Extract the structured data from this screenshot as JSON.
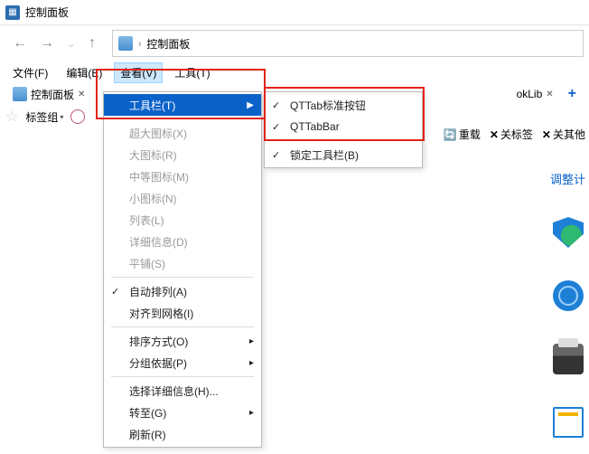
{
  "title": "控制面板",
  "breadcrumb": {
    "root": "控制面板"
  },
  "menubar": {
    "file": "文件(F)",
    "edit": "编辑(E)",
    "view": "查看(V)",
    "tools": "工具(T)"
  },
  "tabs": {
    "tab1": "控制面板",
    "tab2_suffix": "okLib"
  },
  "tabbar": {
    "label": "标签组"
  },
  "right_tools": {
    "reset": "重载",
    "close_tab": "关标签",
    "close_other": "关其他"
  },
  "adjust_link": "调整计",
  "view_menu": {
    "toolbar": "工具栏(T)",
    "xl_icons": "超大图标(X)",
    "l_icons": "大图标(R)",
    "m_icons": "中等图标(M)",
    "s_icons": "小图标(N)",
    "list": "列表(L)",
    "details": "详细信息(D)",
    "tiles": "平铺(S)",
    "auto_arrange": "自动排列(A)",
    "align_grid": "对齐到网格(I)",
    "sort_by": "排序方式(O)",
    "group_by": "分组依据(P)",
    "choose_details": "选择详细信息(H)...",
    "goto": "转至(G)",
    "refresh": "刷新(R)"
  },
  "toolbar_menu": {
    "qttab_std": "QTTab标准按钮",
    "qttabbar": "QTTabBar",
    "lock": "锁定工具栏(B)"
  }
}
